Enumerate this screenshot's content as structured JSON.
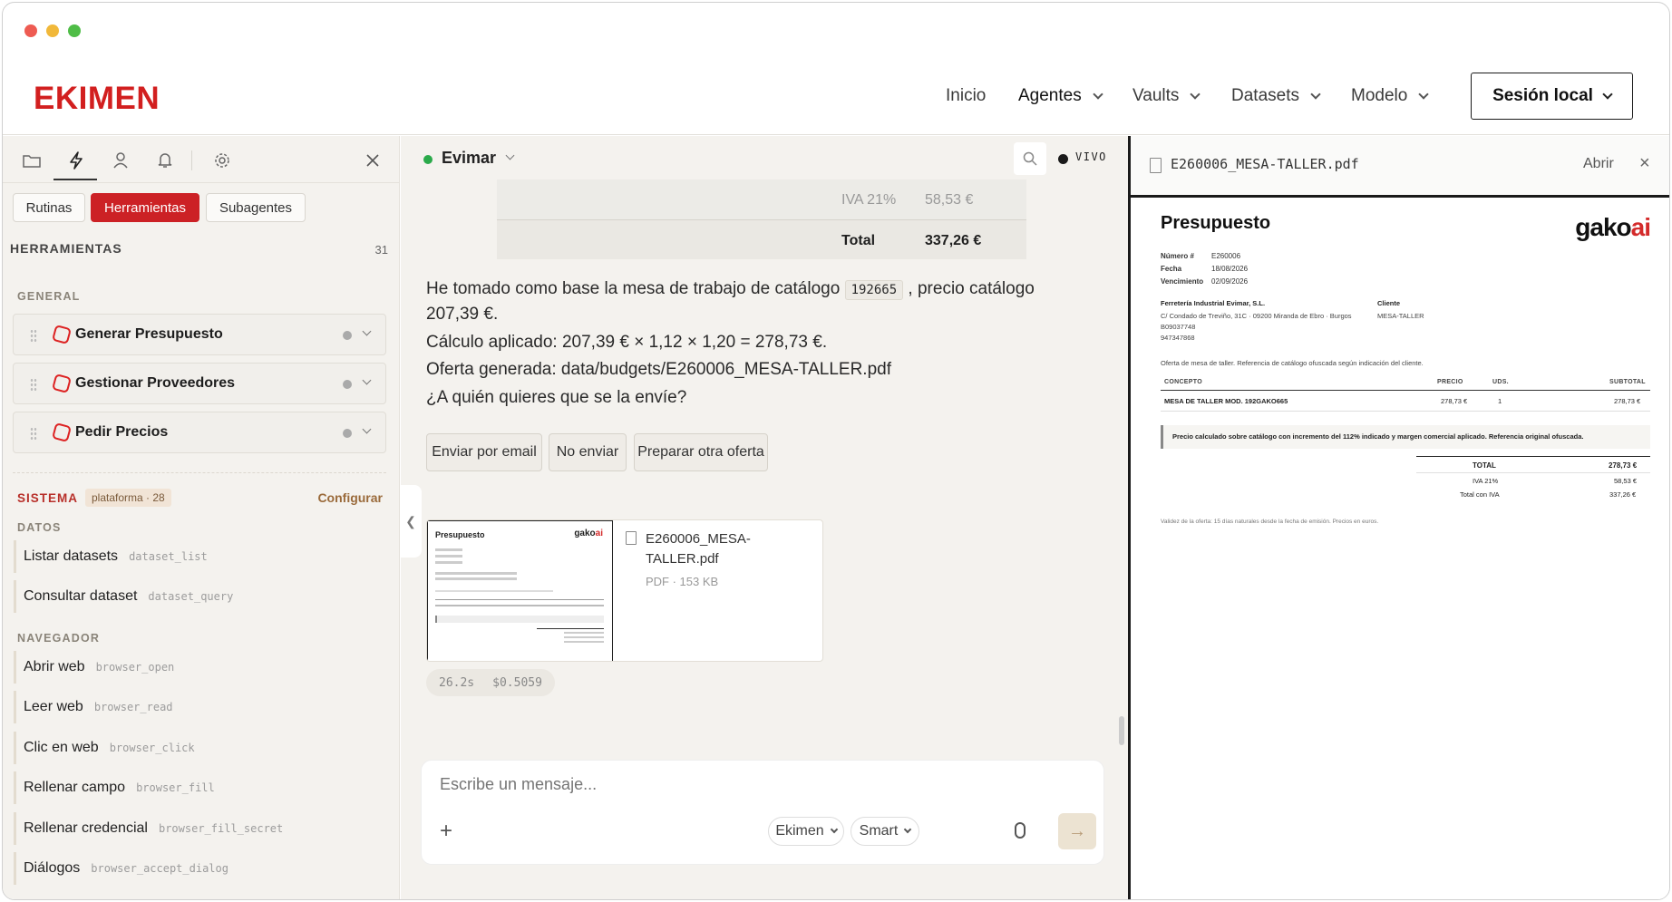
{
  "header": {
    "logo": "EKIMEN",
    "nav": [
      "Inicio",
      "Agentes",
      "Vaults",
      "Datasets",
      "Modelo"
    ],
    "session_label": "Sesión local"
  },
  "sidebar": {
    "icons": [
      "folder-icon",
      "bolt-icon",
      "user-icon",
      "bell-icon",
      "settings-icon",
      "close-icon"
    ],
    "tabs": [
      "Rutinas",
      "Herramientas",
      "Subagentes"
    ],
    "title": "HERRAMIENTAS",
    "count": "31",
    "general_label": "GENERAL",
    "tools": [
      "Generar Presupuesto",
      "Gestionar Proveedores",
      "Pedir Precios"
    ],
    "system_label": "SISTEMA",
    "system_badge": "plataforma · 28",
    "configure": "Configurar",
    "datos_label": "DATOS",
    "datos": [
      {
        "label": "Listar datasets",
        "code": "dataset_list"
      },
      {
        "label": "Consultar dataset",
        "code": "dataset_query"
      }
    ],
    "nav_label": "NAVEGADOR",
    "navegador": [
      {
        "label": "Abrir web",
        "code": "browser_open"
      },
      {
        "label": "Leer web",
        "code": "browser_read"
      },
      {
        "label": "Clic en web",
        "code": "browser_click"
      },
      {
        "label": "Rellenar campo",
        "code": "browser_fill"
      },
      {
        "label": "Rellenar credencial",
        "code": "browser_fill_secret"
      },
      {
        "label": "Diálogos",
        "code": "browser_accept_dialog"
      }
    ]
  },
  "chat": {
    "agent": "Evimar",
    "live": "VIVO",
    "table": {
      "iva_label": "IVA 21%",
      "iva_value": "58,53 €",
      "total_label": "Total",
      "total_value": "337,26 €"
    },
    "msg1_before": "He tomado como base la mesa de trabajo de catálogo ",
    "msg1_code": "192665",
    "msg1_after": " , precio catálogo",
    "msg1_line2": "207,39 €.",
    "msg2": "Cálculo aplicado: 207,39 € × 1,12 × 1,20 = 278,73 €.",
    "msg3": "Oferta generada: data/budgets/E260006_MESA-TALLER.pdf",
    "msg4": "¿A quién quieres que se la envíe?",
    "actions": [
      "Enviar por email",
      "No enviar",
      "Preparar otra oferta"
    ],
    "attachment": {
      "name": "E260006_MESA-TALLER.pdf",
      "meta": "PDF · 153 KB"
    },
    "stats": {
      "time": "26.2s",
      "cost": "$0.5059"
    },
    "composer": {
      "placeholder": "Escribe un mensaje...",
      "agent_pill": "Ekimen",
      "mode_pill": "Smart"
    }
  },
  "preview": {
    "filename": "E260006_MESA-TALLER.pdf",
    "open": "Abrir",
    "doc": {
      "title": "Presupuesto",
      "logo_text": "gako",
      "logo_accent": "ai",
      "numero_label": "Número #",
      "numero": "E260006",
      "fecha_label": "Fecha",
      "fecha": "18/08/2026",
      "venc_label": "Vencimiento",
      "venc": "02/09/2026",
      "company": "Ferretería Industrial Evimar, S.L.",
      "address": "C/ Condado de Treviño, 31C · 09200 Miranda de Ebro · Burgos",
      "cif": "B09037748",
      "phone": "947347868",
      "client_label": "Cliente",
      "client": "MESA-TALLER",
      "intro": "Oferta de mesa de taller. Referencia de catálogo ofuscada según indicación del cliente.",
      "cols": [
        "CONCEPTO",
        "PRECIO",
        "UDS.",
        "SUBTOTAL"
      ],
      "row": {
        "concept": "MESA DE TALLER MOD. 192GAKO665",
        "price": "278,73 €",
        "qty": "1",
        "subtotal": "278,73 €"
      },
      "note": "Precio calculado sobre catálogo con incremento del 112% indicado y margen comercial aplicado. Referencia original ofuscada.",
      "total_label": "TOTAL",
      "total": "278,73 €",
      "iva_label": "IVA 21%",
      "iva": "58,53 €",
      "total_iva_label": "Total con IVA",
      "total_iva": "337,26 €",
      "footer": "Validez de la oferta: 15 días naturales desde la fecha de emisión. Precios en euros."
    }
  }
}
